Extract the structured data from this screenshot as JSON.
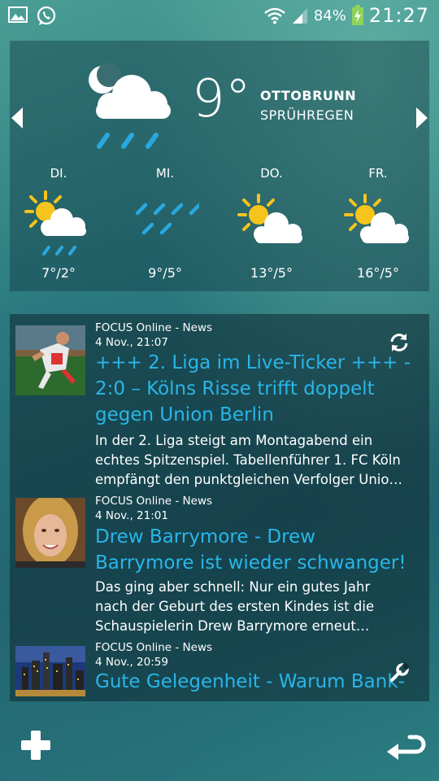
{
  "status_bar": {
    "icons_left": [
      "gallery-icon",
      "whatsapp-icon"
    ],
    "icons_right": [
      "wifi-icon",
      "signal-icon",
      "battery-charging-icon"
    ],
    "battery": "84%",
    "time": "21:27"
  },
  "weather": {
    "current_temp": "9°",
    "location": "OTTOBRUNN",
    "condition": "SPRÜHREGEN",
    "current_icon": "night-cloud-rain-icon",
    "forecast": [
      {
        "day": "DI.",
        "range": "7°/2°",
        "icon": "sun-cloud-rain-icon"
      },
      {
        "day": "MI.",
        "range": "9°/5°",
        "icon": "rain-icon"
      },
      {
        "day": "DO.",
        "range": "13°/5°",
        "icon": "sun-cloud-icon"
      },
      {
        "day": "FR.",
        "range": "16°/5°",
        "icon": "sun-cloud-icon"
      }
    ]
  },
  "news": {
    "items": [
      {
        "source": "FOCUS Online - News",
        "date": "4 Nov., 21:07",
        "headline_lines": [
          "+++ 2. Liga im Live-Ticker +++ -",
          "2:0 – Kölns Risse trifft doppelt",
          "gegen Union Berlin"
        ],
        "body_lines": [
          "In der 2. Liga steigt am Montagabend ein",
          "echtes Spitzenspiel. Tabellenführer 1. FC Köln",
          "empfängt den punktgleichen Verfolger Unio…"
        ]
      },
      {
        "source": "FOCUS Online - News",
        "date": "4 Nov., 21:01",
        "headline_lines": [
          "Drew Barrymore - Drew",
          "Barrymore ist wieder schwanger!"
        ],
        "body_lines": [
          "Das ging aber schnell: Nur ein gutes Jahr",
          "nach der Geburt des ersten Kindes ist die",
          "Schauspielerin Drew Barrymore erneut…"
        ]
      },
      {
        "source": "FOCUS Online - News",
        "date": "4 Nov., 20:59",
        "headline_lines": [
          "Gute Gelegenheit - Warum Bank-"
        ],
        "body_lines": []
      }
    ]
  },
  "colors": {
    "accent": "#29b6e8",
    "sun": "#f6c41c",
    "rain": "#29a8e0"
  }
}
